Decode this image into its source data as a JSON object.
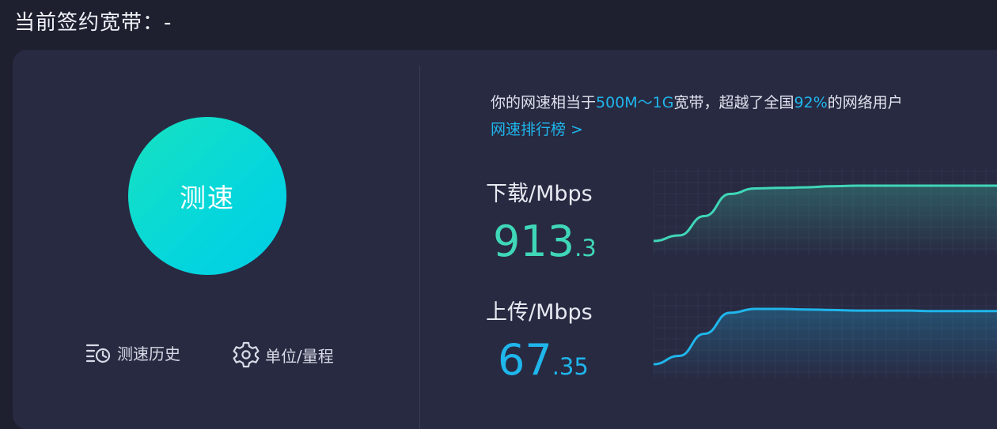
{
  "header": {
    "title": "当前签约宽带：-"
  },
  "left": {
    "speed_button": "测速",
    "history_label": "测速历史",
    "unit_label": "单位/量程"
  },
  "result": {
    "prefix": "你的网速相当于",
    "band": "500M～1G",
    "middle": "宽带，超越了全国",
    "percent": "92%",
    "suffix": "的网络用户",
    "rank_link": "网速排行榜 >"
  },
  "download": {
    "label": "下载/Mbps",
    "int": "913",
    "dec": ".3",
    "value": 913.3
  },
  "upload": {
    "label": "上传/Mbps",
    "int": "67",
    "dec": ".35",
    "value": 67.35
  },
  "colors": {
    "download": "#3fd7b8",
    "upload": "#1fb6ec",
    "accent": "#1fb6ec"
  },
  "chart_data": [
    {
      "type": "line",
      "series": [
        {
          "values": [
            0.0,
            0.1,
            0.45,
            0.85,
            0.95,
            0.96,
            0.97,
            0.99,
            1.0,
            1.0,
            1.0,
            1.0,
            1.0,
            1.0,
            1.0
          ]
        }
      ]
    },
    {
      "type": "line",
      "series": [
        {
          "values": [
            0.0,
            0.15,
            0.55,
            0.93,
            1.0,
            1.0,
            0.99,
            0.98,
            0.97,
            0.97,
            0.97,
            0.96,
            0.96,
            0.96,
            0.96
          ]
        }
      ]
    }
  ]
}
